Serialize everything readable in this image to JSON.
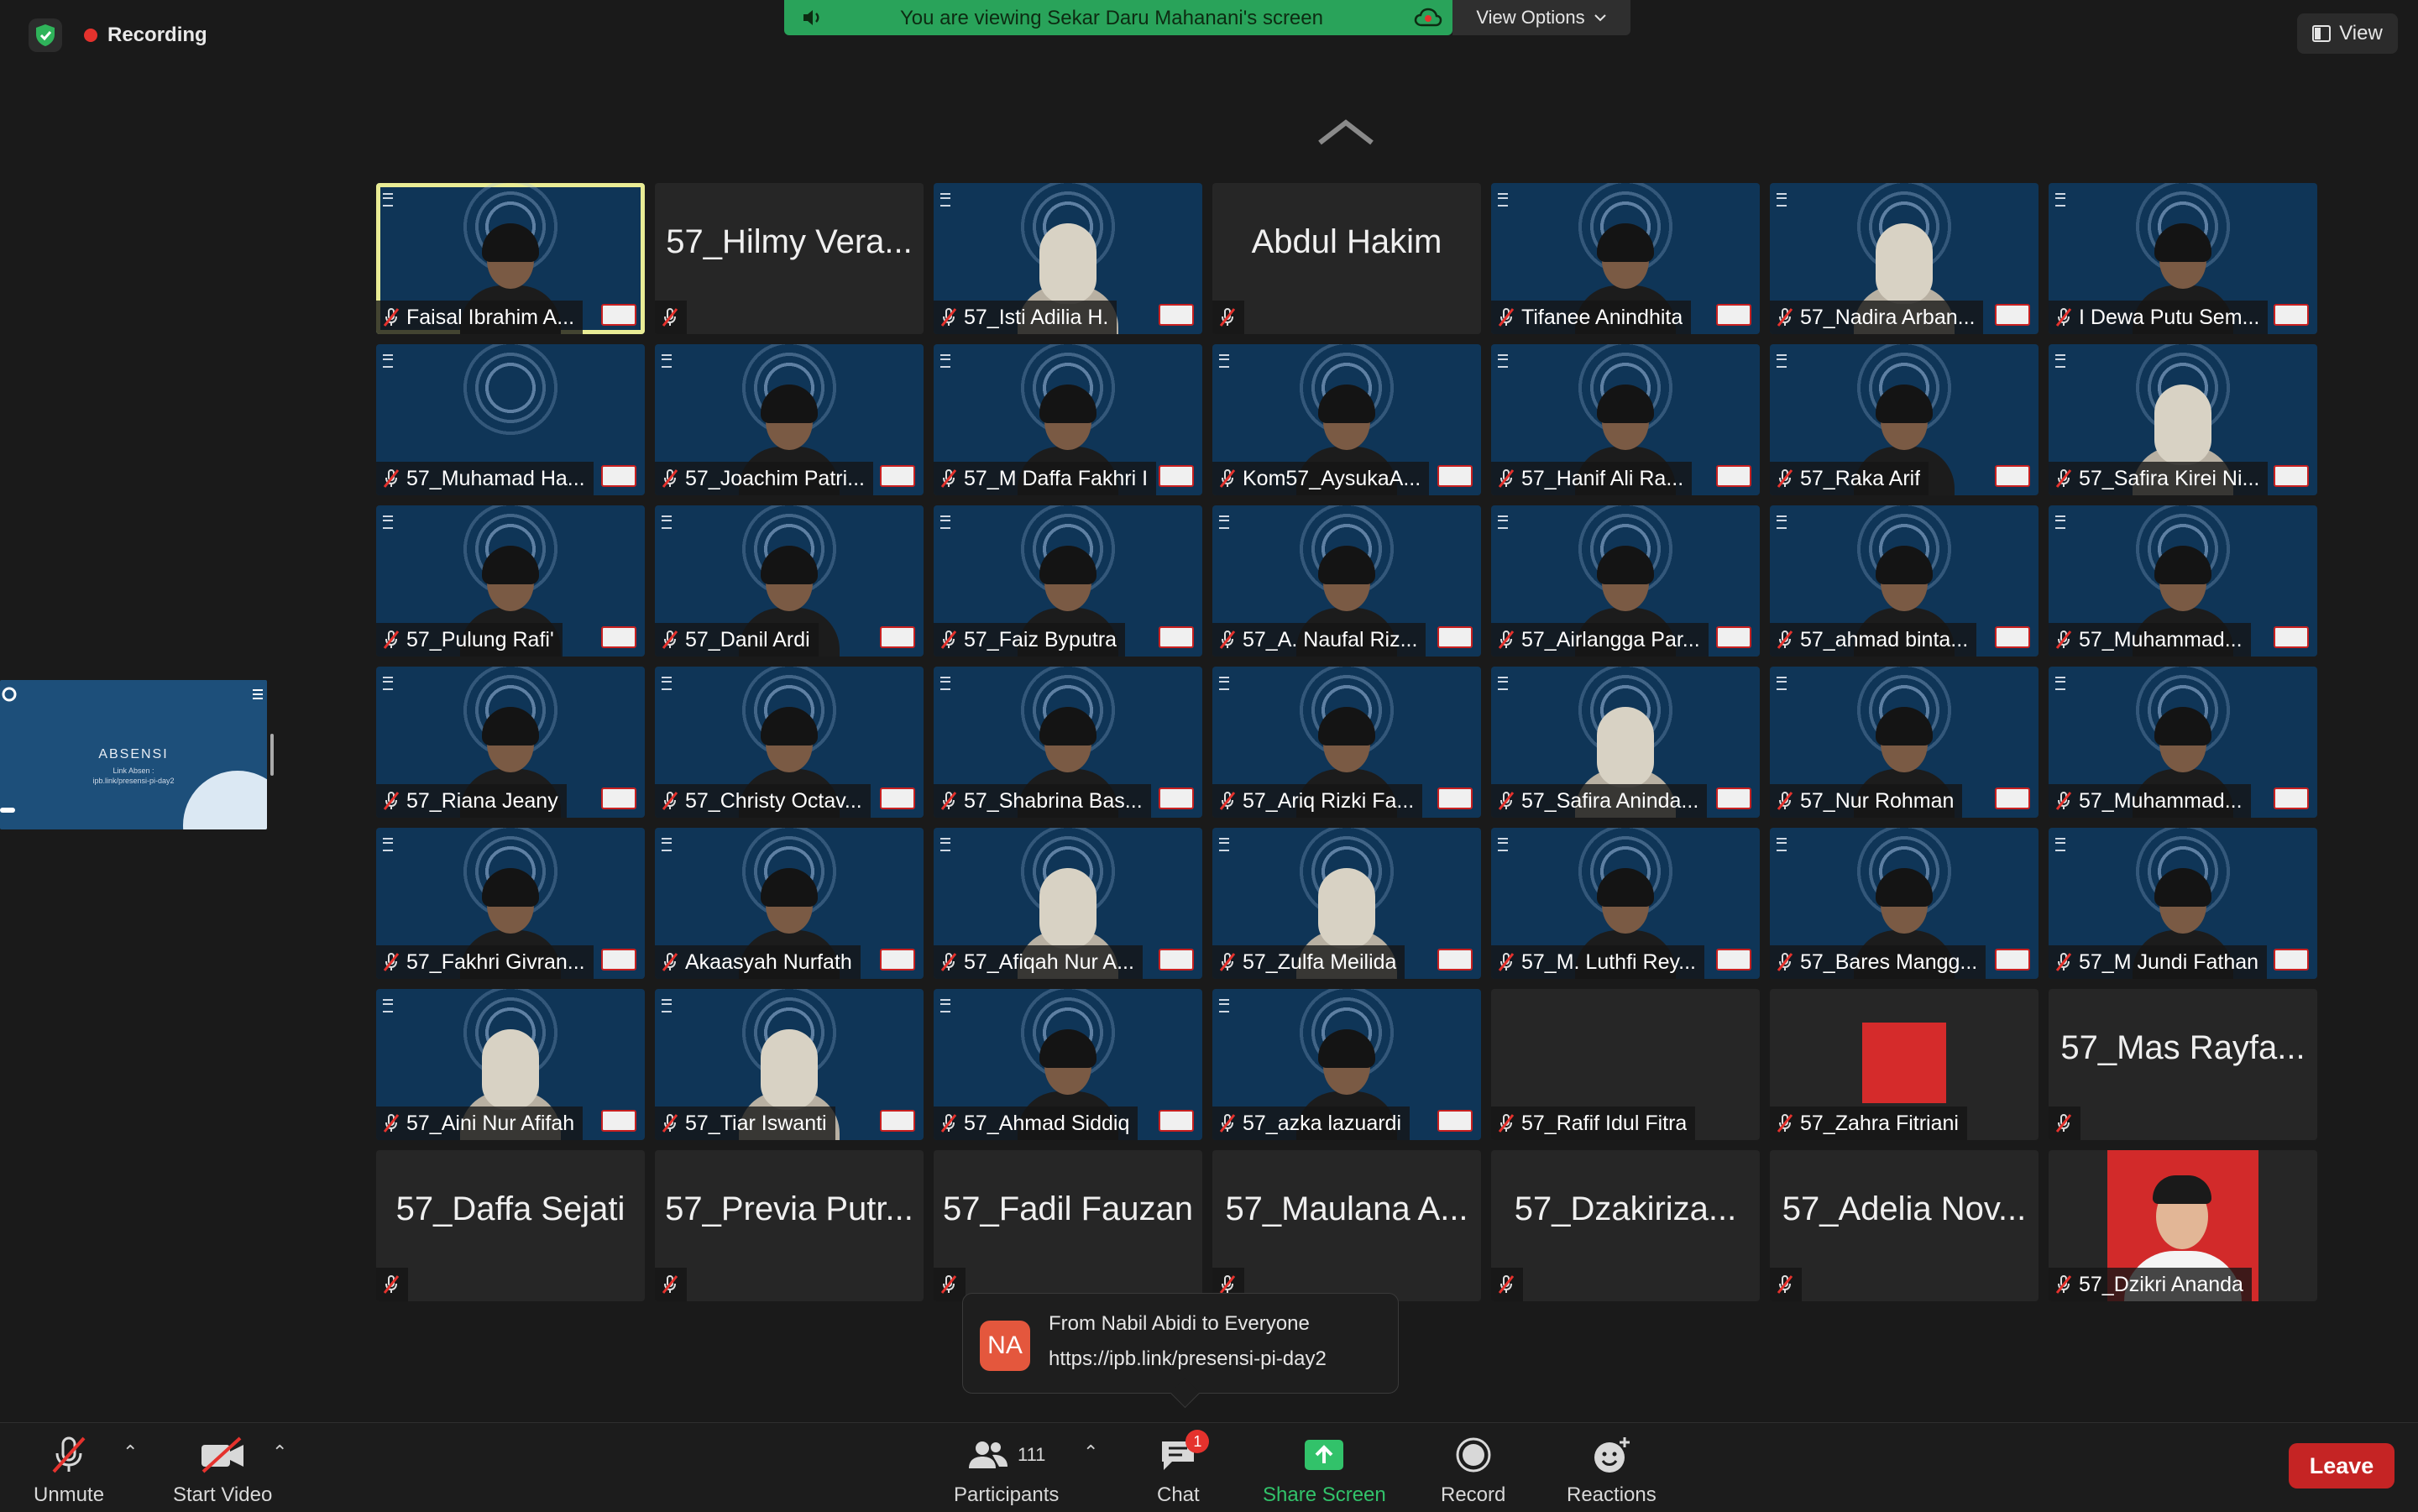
{
  "topbar": {
    "recording_label": "Recording",
    "banner_text": "You are viewing Sekar Daru Mahanani's screen",
    "view_options_label": "View Options",
    "view_label": "View"
  },
  "side_share": {
    "title": "ABSENSI",
    "subtitle_line1": "Link Absen :",
    "subtitle_line2": "ipb.link/presensi-pi-day2"
  },
  "tiles": [
    {
      "name": "Faisal Ibrahim A...",
      "kind": "video",
      "active": true,
      "person": "plain"
    },
    {
      "name": "57_Hilmy Vera...",
      "kind": "text"
    },
    {
      "name": "57_Isti Adilia H.",
      "kind": "video",
      "person": "hijab"
    },
    {
      "name": "Abdul Hakim",
      "kind": "text"
    },
    {
      "name": "Tifanee Anindhita",
      "kind": "video",
      "person": "plain"
    },
    {
      "name": "57_Nadira Arban...",
      "kind": "video",
      "person": "hijab"
    },
    {
      "name": "I Dewa Putu Sem...",
      "kind": "video",
      "person": "plain"
    },
    {
      "name": "57_Muhamad Ha...",
      "kind": "video",
      "person": "none"
    },
    {
      "name": "57_Joachim Patri...",
      "kind": "video",
      "person": "plain"
    },
    {
      "name": "57_M Daffa Fakhri I",
      "kind": "video",
      "person": "plain"
    },
    {
      "name": "Kom57_AysukaA...",
      "kind": "video",
      "person": "plain"
    },
    {
      "name": "57_Hanif Ali Ra...",
      "kind": "video",
      "person": "plain"
    },
    {
      "name": "57_Raka Arif",
      "kind": "video",
      "person": "plain"
    },
    {
      "name": "57_Safira Kirei Ni...",
      "kind": "video",
      "person": "hijab"
    },
    {
      "name": "57_Pulung Rafi'",
      "kind": "video",
      "person": "plain"
    },
    {
      "name": "57_Danil Ardi",
      "kind": "video",
      "person": "plain"
    },
    {
      "name": "57_Faiz Byputra",
      "kind": "video",
      "person": "plain"
    },
    {
      "name": "57_A. Naufal Riz...",
      "kind": "video",
      "person": "plain"
    },
    {
      "name": "57_Airlangga Par...",
      "kind": "video",
      "person": "plain"
    },
    {
      "name": "57_ahmad binta...",
      "kind": "video",
      "person": "plain"
    },
    {
      "name": "57_Muhammad...",
      "kind": "video",
      "person": "plain"
    },
    {
      "name": "57_Riana Jeany",
      "kind": "video",
      "person": "plain"
    },
    {
      "name": "57_Christy Octav...",
      "kind": "video",
      "person": "plain"
    },
    {
      "name": "57_Shabrina Bas...",
      "kind": "video",
      "person": "plain"
    },
    {
      "name": "57_Ariq Rizki Fa...",
      "kind": "video",
      "person": "plain"
    },
    {
      "name": "57_Safira Aninda...",
      "kind": "video",
      "person": "hijab"
    },
    {
      "name": "57_Nur Rohman",
      "kind": "video",
      "person": "plain"
    },
    {
      "name": "57_Muhammad...",
      "kind": "video",
      "person": "plain"
    },
    {
      "name": "57_Fakhri Givran...",
      "kind": "video",
      "person": "plain"
    },
    {
      "name": "Akaasyah Nurfath",
      "kind": "video",
      "person": "plain"
    },
    {
      "name": "57_Afiqah Nur A...",
      "kind": "video",
      "person": "hijab"
    },
    {
      "name": "57_Zulfa Meilida",
      "kind": "video",
      "person": "hijab"
    },
    {
      "name": "57_M. Luthfi Rey...",
      "kind": "video",
      "person": "plain"
    },
    {
      "name": "57_Bares Mangg...",
      "kind": "video",
      "person": "plain"
    },
    {
      "name": "57_M Jundi Fathan",
      "kind": "video",
      "person": "plain"
    },
    {
      "name": "57_Aini Nur Afifah",
      "kind": "video",
      "person": "hijab"
    },
    {
      "name": "57_Tiar Iswanti",
      "kind": "video",
      "person": "hijab"
    },
    {
      "name": "57_Ahmad Siddiq",
      "kind": "video",
      "person": "plain"
    },
    {
      "name": "57_azka lazuardi",
      "kind": "video",
      "person": "plain"
    },
    {
      "name": "57_Rafif Idul Fitra",
      "kind": "blank"
    },
    {
      "name": "57_Zahra Fitriani",
      "kind": "redbox"
    },
    {
      "name": "57_Mas Rayfa...",
      "kind": "text"
    },
    {
      "name": "57_Daffa Sejati",
      "kind": "text"
    },
    {
      "name": "57_Previa Putr...",
      "kind": "text"
    },
    {
      "name": "57_Fadil Fauzan",
      "kind": "text"
    },
    {
      "name": "57_Maulana A...",
      "kind": "text"
    },
    {
      "name": "57_Dzakiriza...",
      "kind": "text"
    },
    {
      "name": "57_Adelia Nov...",
      "kind": "text"
    },
    {
      "name": "57_Dzikri Ananda",
      "kind": "photo"
    }
  ],
  "chat_toast": {
    "avatar_initials": "NA",
    "from": "From Nabil Abidi to Everyone",
    "message": "https://ipb.link/presensi-pi-day2"
  },
  "toolbar": {
    "unmute": "Unmute",
    "start_video": "Start Video",
    "participants": "Participants",
    "participants_count": "111",
    "chat": "Chat",
    "chat_badge": "1",
    "share_screen": "Share Screen",
    "record": "Record",
    "reactions": "Reactions",
    "leave": "Leave"
  },
  "colors": {
    "share_green": "#29a35a",
    "leave_red": "#c52424",
    "recording_dot": "#e5322d",
    "active_speaker": "#e9ec95"
  }
}
